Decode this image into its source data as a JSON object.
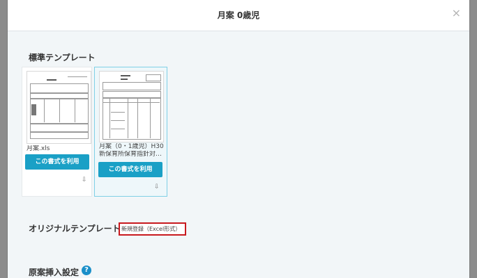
{
  "modal": {
    "title": "月案 0歳児",
    "close_glyph": "×"
  },
  "standard_section": {
    "title": "標準テンプレート",
    "templates": [
      {
        "name_lines": [
          "月案.xls"
        ],
        "use_label": "この書式を利用",
        "download_glyph": "⇩"
      },
      {
        "name_lines": [
          "月案（0・1歳児）H30",
          "新保育所保育指針対…"
        ],
        "use_label": "この書式を利用",
        "download_glyph": "⇩",
        "selected": true
      }
    ]
  },
  "original_section": {
    "title": "オリジナルテンプレート",
    "new_register_label": "新規登録（Excel形式）"
  },
  "insert_section": {
    "title": "原案挿入設定",
    "help_glyph": "?"
  },
  "colors": {
    "accent": "#1aa0c6",
    "highlight_border": "#c8191e",
    "overlay": "#8c8c8c"
  }
}
